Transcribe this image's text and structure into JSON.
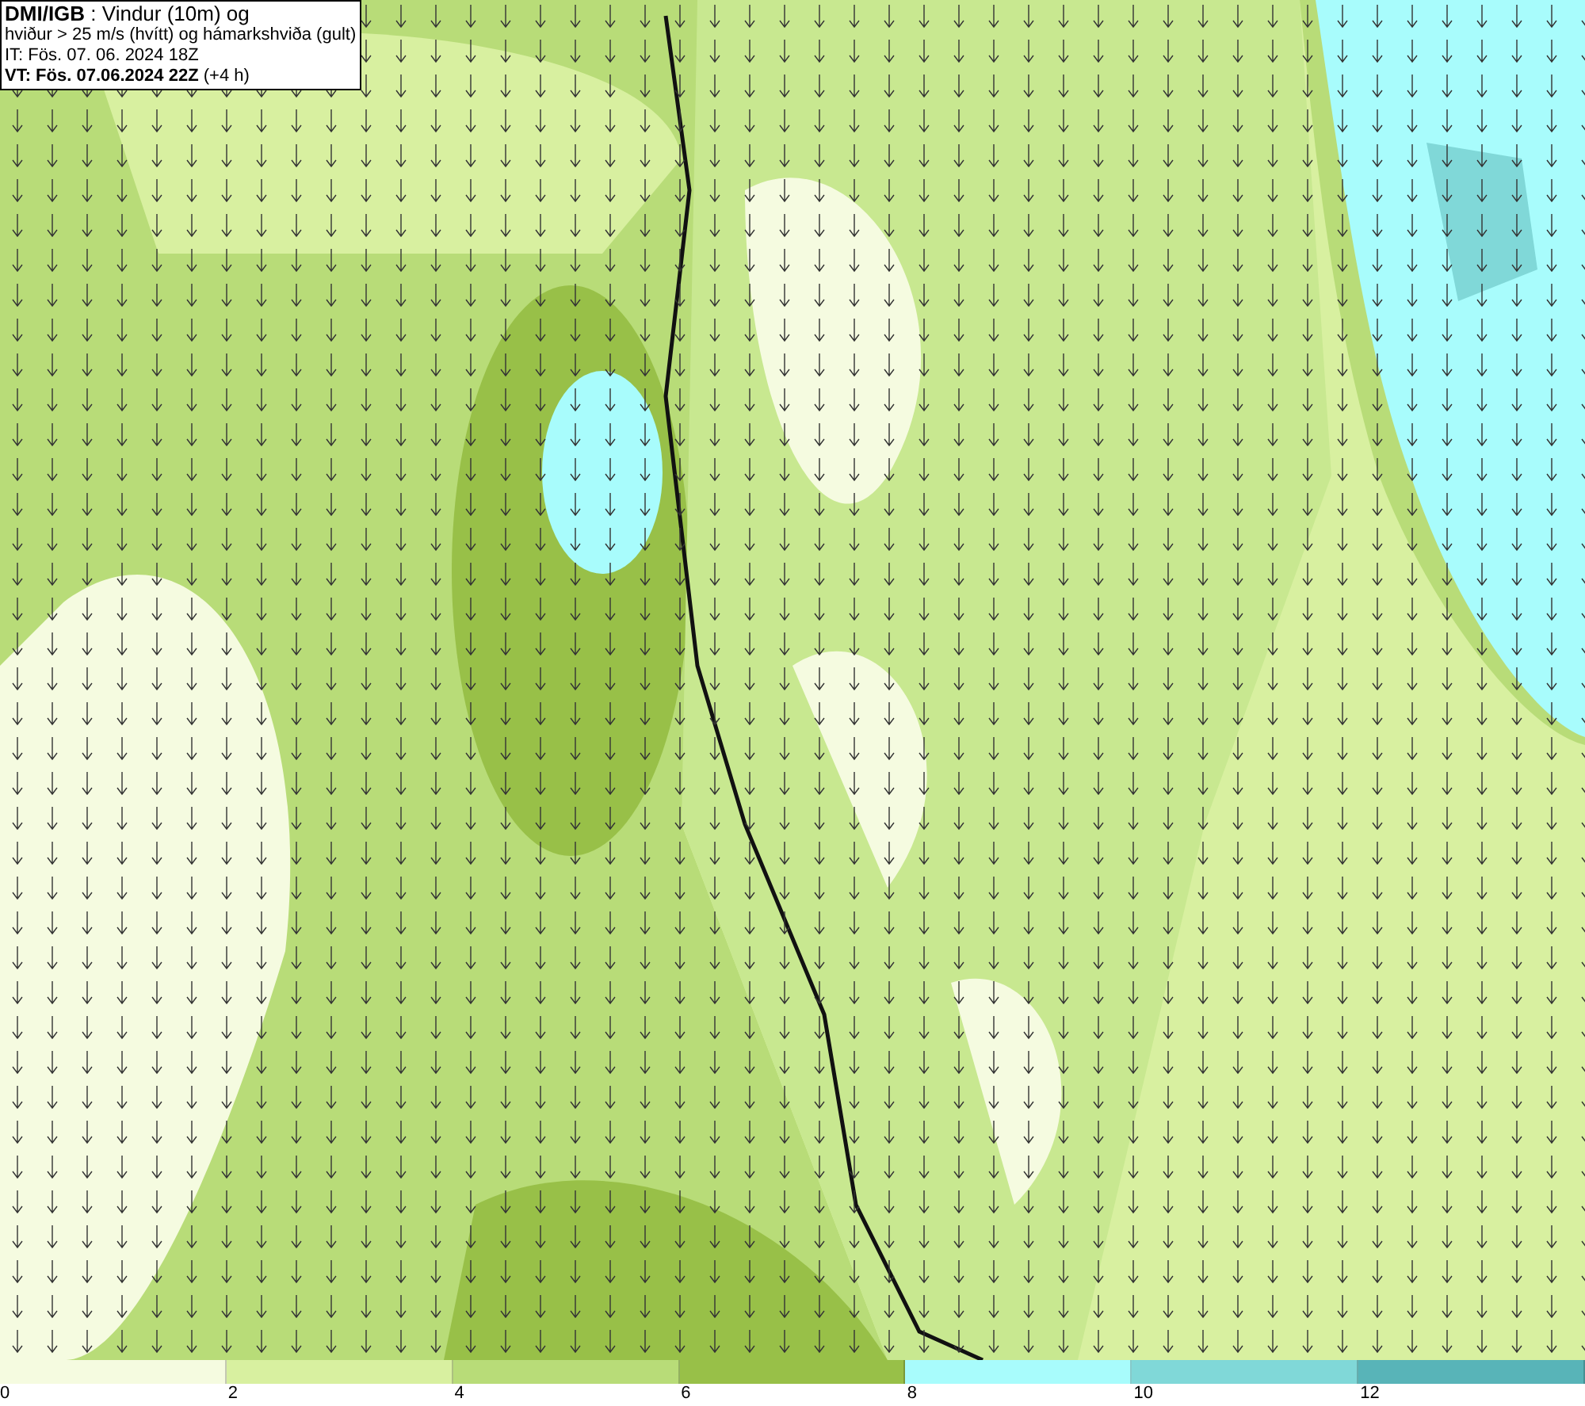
{
  "header": {
    "lines": [
      "**DMI/IGB** : Vindur (10m) og",
      "hviður > 25 m/s (hvítt) og hámarkshviða (gult)",
      "IT: Fös. 07. 06. 2024 18Z",
      "**VT: Fös. 07.06.2024 22Z** (+4 h)"
    ]
  },
  "legend": {
    "bins": [
      {
        "color": "#f5fbe0"
      },
      {
        "color": "#d8f0a0"
      },
      {
        "color": "#b8dc78"
      },
      {
        "color": "#98c048"
      },
      {
        "color": "#a8fcfc"
      },
      {
        "color": "#80d8d8"
      },
      {
        "color": "#58b4b8"
      }
    ],
    "ticks": [
      "0",
      "2",
      "4",
      "6",
      "8",
      "10",
      "12"
    ]
  }
}
